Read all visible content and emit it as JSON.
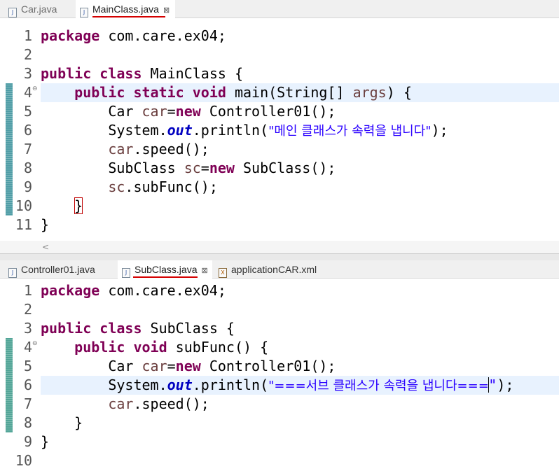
{
  "top_editor": {
    "tabs": [
      {
        "label": "Car.java",
        "active": false
      },
      {
        "label": "MainClass.java",
        "active": true,
        "close": "⊠"
      }
    ],
    "line_numbers": [
      "1",
      "2",
      "3",
      "4",
      "5",
      "6",
      "7",
      "8",
      "9",
      "10",
      "11"
    ],
    "tokens": {
      "l1_kw": "package",
      "l1_rest": " com.care.ex04;",
      "l3_kw1": "public",
      "l3_kw2": "class",
      "l3_rest": " MainClass {",
      "l4_kw1": "public",
      "l4_kw2": "static",
      "l4_kw3": "void",
      "l4_rest1": " main(String[] ",
      "l4_var": "args",
      "l4_rest2": ") {",
      "l5_a": "Car ",
      "l5_var": "car",
      "l5_eq": "=",
      "l5_kw": "new",
      "l5_rest": " Controller01();",
      "l6_a": "System.",
      "l6_static": "out",
      "l6_b": ".println(",
      "l6_str": "\"메인 클래스가 속력을 냅니다\"",
      "l6_end": ");",
      "l7_var": "car",
      "l7_rest": ".speed();",
      "l8_a": "SubClass ",
      "l8_var": "sc",
      "l8_eq": "=",
      "l8_kw": "new",
      "l8_rest": " SubClass();",
      "l9_var": "sc",
      "l9_rest": ".subFunc();",
      "l10_brace": "}",
      "l11_brace": "}"
    }
  },
  "bottom_editor": {
    "tabs": [
      {
        "label": "Controller01.java",
        "active": false
      },
      {
        "label": "SubClass.java",
        "active": true,
        "close": "⊠"
      },
      {
        "label": "applicationCAR.xml",
        "active": false
      }
    ],
    "line_numbers": [
      "1",
      "2",
      "3",
      "4",
      "5",
      "6",
      "7",
      "8",
      "9",
      "10"
    ],
    "tokens": {
      "l1_kw": "package",
      "l1_rest": " com.care.ex04;",
      "l3_kw1": "public",
      "l3_kw2": "class",
      "l3_rest": " SubClass {",
      "l4_kw1": "public",
      "l4_kw2": "void",
      "l4_rest": " subFunc() {",
      "l5_a": "Car ",
      "l5_var": "car",
      "l5_eq": "=",
      "l5_kw": "new",
      "l5_rest": " Controller01();",
      "l6_a": "System.",
      "l6_static": "out",
      "l6_b": ".println(",
      "l6_str": "\"===서브 클래스가 속력을 냅니다===",
      "l6_str_end": "\"",
      "l6_end": ");",
      "l7_var": "car",
      "l7_rest": ".speed();",
      "l8_brace": "}",
      "l9_brace": "}"
    }
  },
  "scroll": {
    "left_arrow": "<"
  },
  "icons": {
    "java_file": "java-file-icon",
    "xml_file": "xml-file-icon",
    "close": "close-icon"
  },
  "colors": {
    "keyword": "#7f0055",
    "string": "#2a00ff",
    "local_var": "#6a3e3e",
    "static_field": "#0000c0",
    "current_line": "#e8f2fe",
    "tab_underline": "#d40000"
  }
}
